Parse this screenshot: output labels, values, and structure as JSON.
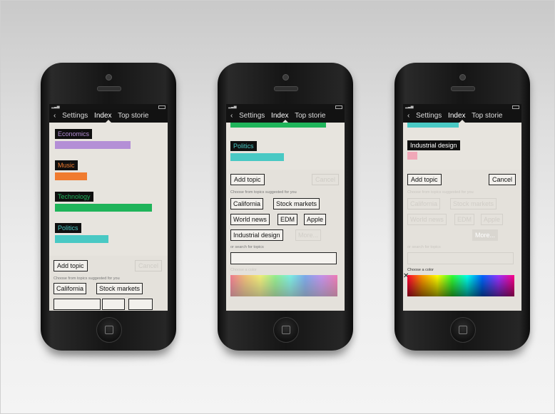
{
  "nav": {
    "back": "‹",
    "settings": "Settings",
    "index": "Index",
    "top_stories": "Top storie"
  },
  "topics": {
    "economics": "Economics",
    "music": "Music",
    "technology": "Technology",
    "politics": "Politics",
    "industrial_design": "Industrial design"
  },
  "colors": {
    "economics": "#b48fd6",
    "music": "#f07b2f",
    "technology": "#1fb45a",
    "politics": "#49c9c4",
    "industrial_design": "#f0a8b8"
  },
  "actions": {
    "add_topic": "Add topic",
    "cancel": "Cancel",
    "suggested_label": "Choose from topics suggested for you",
    "search_label": "or search for topics",
    "color_label": "Choose a color",
    "close_mark": "✕"
  },
  "suggestions": {
    "california": "California",
    "stock_markets": "Stock markets",
    "world_news": "World news",
    "edm": "EDM",
    "apple": "Apple",
    "industrial_design": "Industrial design",
    "more": "More..."
  }
}
